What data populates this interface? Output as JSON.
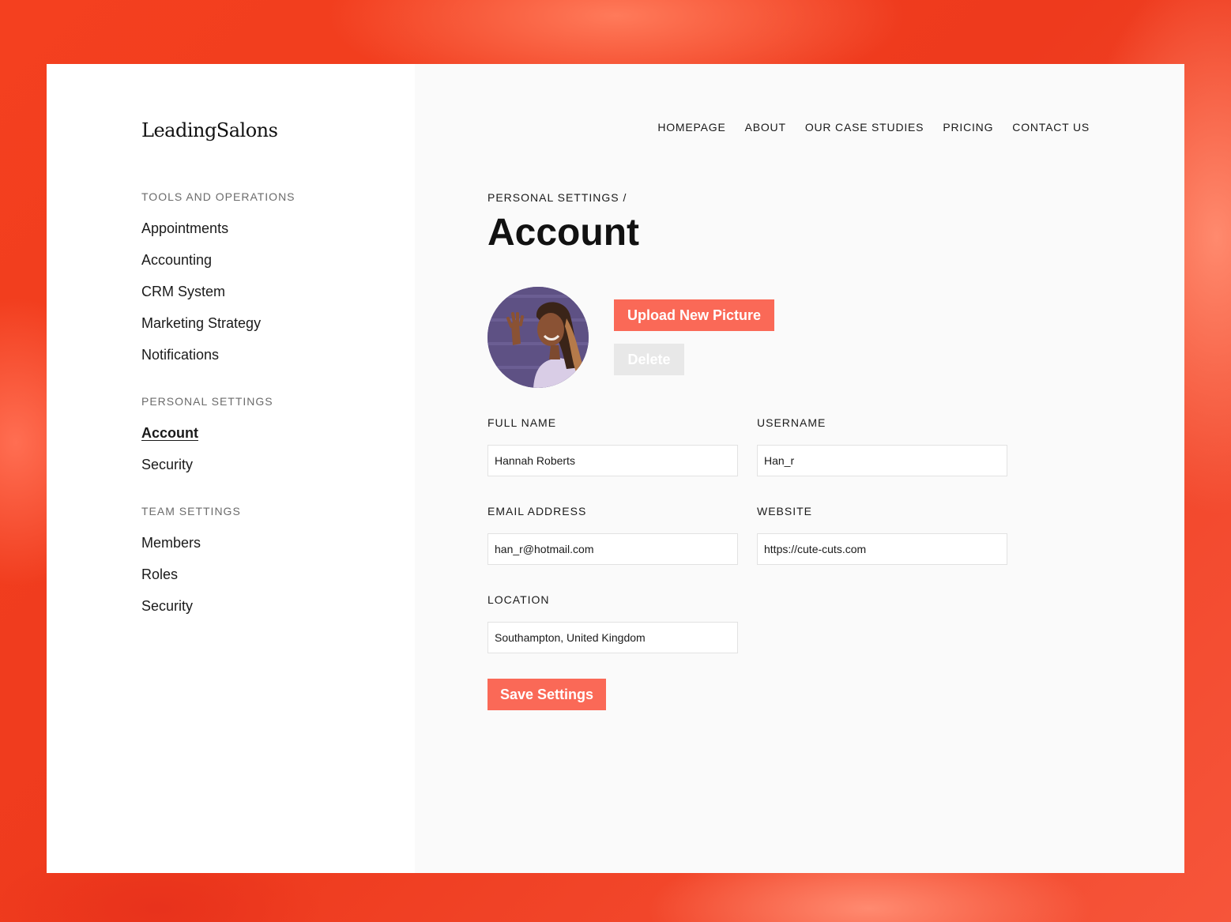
{
  "brand": {
    "logo": "LeadingSalons",
    "accent": "#fa6957",
    "background": "#f2371f"
  },
  "topnav": [
    "HOMEPAGE",
    "ABOUT",
    "OUR CASE STUDIES",
    "PRICING",
    "CONTACT US"
  ],
  "sidebar": {
    "groups": [
      {
        "title": "TOOLS AND OPERATIONS",
        "items": [
          "Appointments",
          "Accounting",
          "CRM System",
          "Marketing Strategy",
          "Notifications"
        ]
      },
      {
        "title": "PERSONAL SETTINGS",
        "items": [
          "Account",
          "Security"
        ],
        "active": "Account"
      },
      {
        "title": "TEAM SETTINGS",
        "items": [
          "Members",
          "Roles",
          "Security"
        ]
      }
    ]
  },
  "main": {
    "breadcrumb": "PERSONAL SETTINGS /",
    "title": "Account",
    "upload_label": "Upload New Picture",
    "delete_label": "Delete",
    "save_label": "Save Settings",
    "fields": {
      "full_name": {
        "label": "FULL NAME",
        "value": "Hannah Roberts"
      },
      "username": {
        "label": "USERNAME",
        "value": "Han_r"
      },
      "email": {
        "label": "EMAIL ADDRESS",
        "value": "han_r@hotmail.com"
      },
      "website": {
        "label": "WEBSITE",
        "value": "https://cute-cuts.com"
      },
      "location": {
        "label": "LOCATION",
        "value": "Southampton, United Kingdom"
      }
    }
  }
}
